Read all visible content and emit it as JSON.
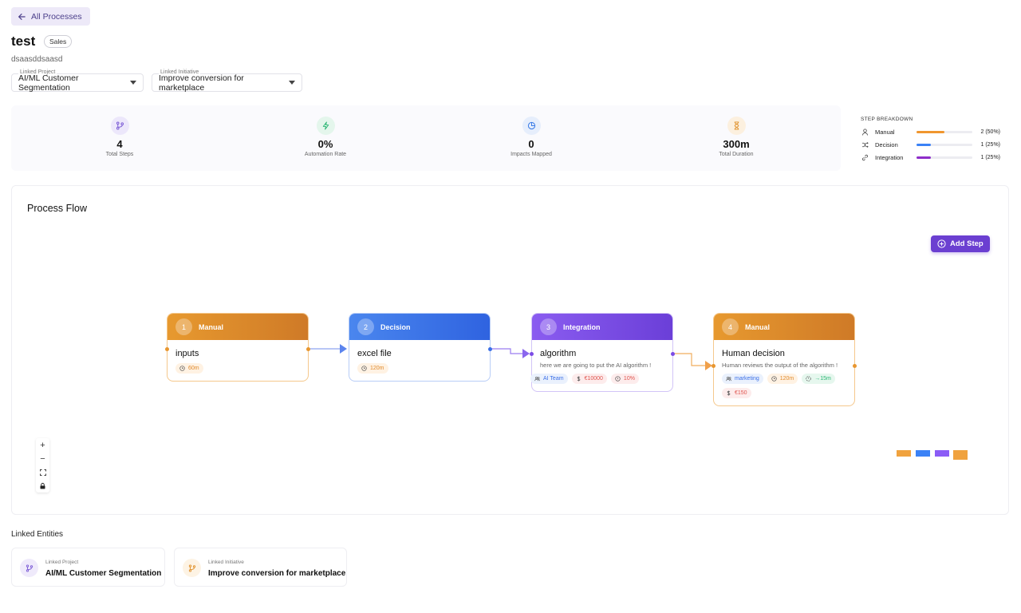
{
  "header": {
    "back_label": "All Processes",
    "title": "test",
    "tag": "Sales",
    "subtitle": "dsaasddsaasd",
    "linked_project": {
      "label": "Linked Project",
      "value": "AI/ML Customer Segmentation"
    },
    "linked_initiative": {
      "label": "Linked Initiative",
      "value": "Improve conversion for marketplace"
    }
  },
  "stats": [
    {
      "value": "4",
      "caption": "Total Steps",
      "icon": "git-branch-icon",
      "color": "#7c5cd6"
    },
    {
      "value": "0%",
      "caption": "Automation Rate",
      "icon": "bolt-icon",
      "color": "#2bb673"
    },
    {
      "value": "0",
      "caption": "Impacts Mapped",
      "icon": "pie-chart-icon",
      "color": "#3b7be6"
    },
    {
      "value": "300m",
      "caption": "Total Duration",
      "icon": "hourglass-icon",
      "color": "#e0902a"
    }
  ],
  "breakdown": {
    "heading": "STEP BREAKDOWN",
    "rows": [
      {
        "label": "Manual",
        "count": "2 (50%)",
        "fraction": 0.5,
        "color": "#f0962e",
        "icon": "user-icon"
      },
      {
        "label": "Decision",
        "count": "1 (25%)",
        "fraction": 0.25,
        "color": "#3b82f6",
        "icon": "shuffle-icon"
      },
      {
        "label": "Integration",
        "count": "1 (25%)",
        "fraction": 0.25,
        "color": "#8e2ec9",
        "icon": "link-icon"
      }
    ]
  },
  "flow": {
    "title": "Process Flow",
    "add_step_label": "Add Step",
    "nodes": [
      {
        "num": "1",
        "type": "Manual",
        "title": "inputs",
        "desc": "",
        "chips": [
          {
            "kind": "duration",
            "text": "60m"
          }
        ]
      },
      {
        "num": "2",
        "type": "Decision",
        "title": "excel file",
        "desc": "",
        "chips": [
          {
            "kind": "duration",
            "text": "120m"
          }
        ]
      },
      {
        "num": "3",
        "type": "Integration",
        "title": "algorithm",
        "desc": "here we are going to put the AI algorithm !",
        "chips": [
          {
            "kind": "team",
            "text": "AI Team"
          },
          {
            "kind": "cost",
            "text": "€10000"
          },
          {
            "kind": "error",
            "text": "10%"
          }
        ]
      },
      {
        "num": "4",
        "type": "Manual",
        "title": "Human decision",
        "desc": "Human reviews the output of the algorithm !",
        "chips": [
          {
            "kind": "team",
            "text": "marketing"
          },
          {
            "kind": "duration",
            "text": "120m"
          },
          {
            "kind": "saving",
            "text": "→15m"
          },
          {
            "kind": "cost",
            "text": "€150"
          }
        ]
      }
    ],
    "zoom": [
      "+",
      "−",
      "⛶",
      "🔒"
    ]
  },
  "colors": {
    "manual": "#e08a2c",
    "decision": "#3b6fe6",
    "integration": "#7b4be6"
  },
  "linked_entities": {
    "title": "Linked Entities",
    "items": [
      {
        "label": "Linked Project",
        "value": "AI/ML Customer Segmentation",
        "icon": "git-branch-icon"
      },
      {
        "label": "Linked Initiative",
        "value": "Improve conversion for marketplace",
        "icon": "git-branch-icon"
      }
    ]
  }
}
